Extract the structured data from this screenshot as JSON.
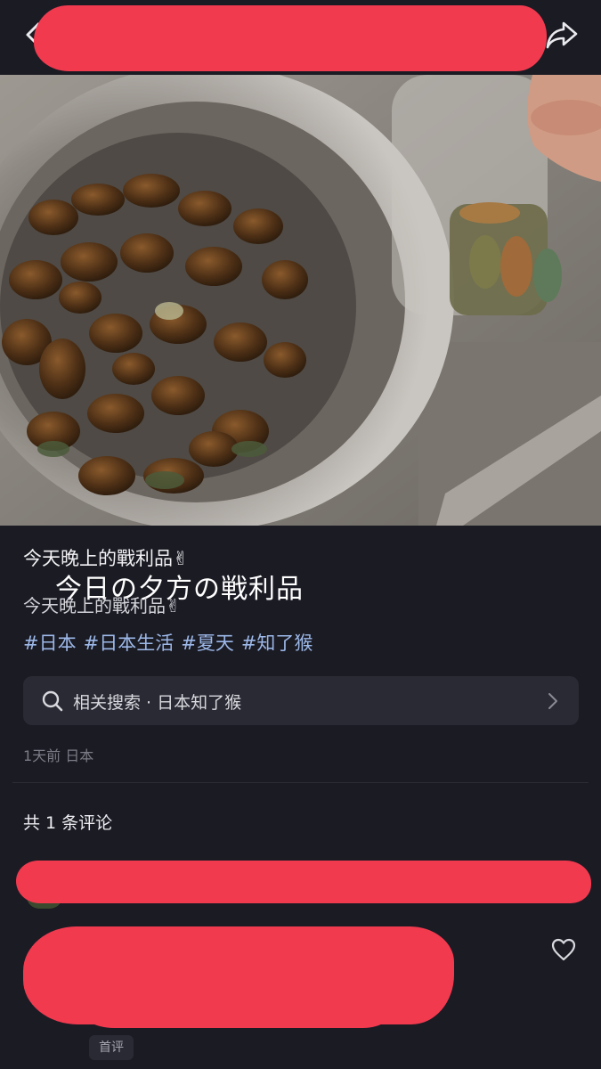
{
  "post": {
    "title": "今天晚上的戰利品✌",
    "overlay_caption": "今日の夕方の戦利品",
    "body": "今天晚上的戰利品✌",
    "tags": [
      "#日本",
      "#日本生活",
      "#夏天",
      "#知了猴"
    ],
    "meta": "1天前 日本"
  },
  "related_search": {
    "label": "相关搜索 · 日本知了猴"
  },
  "comments": {
    "count_label": "共 1 条评论",
    "first_badge": "首评"
  },
  "icons": {
    "back": "chevron-left-icon",
    "share": "share-arrow-icon",
    "search": "search-icon",
    "chevron": "chevron-right-icon",
    "like": "heart-icon"
  },
  "colors": {
    "background": "#1b1b24",
    "tag": "#9cb8e8",
    "redaction": "#f23a4f",
    "search_box": "#2a2a34"
  }
}
